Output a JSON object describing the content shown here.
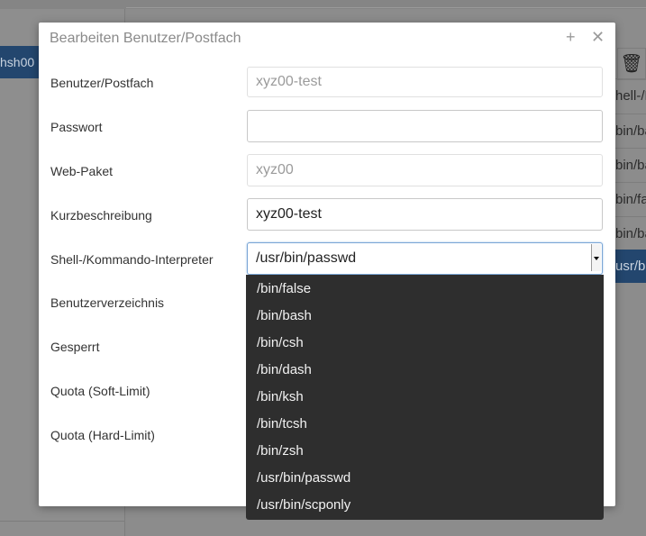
{
  "background": {
    "left_selected_text": "hsh00",
    "right_rows": [
      "hell-/K",
      "bin/ba",
      "bin/ba",
      "bin/fal",
      "bin/ba"
    ],
    "right_selected_text": "usr/bi",
    "trash_icon": "trash-icon"
  },
  "dialog": {
    "title": "Bearbeiten Benutzer/Postfach",
    "maximize_icon": "plus-icon",
    "close_icon": "close-icon",
    "fields": {
      "user": {
        "label": "Benutzer/Postfach",
        "value": "xyz00-test"
      },
      "password": {
        "label": "Passwort",
        "value": ""
      },
      "webpackage": {
        "label": "Web-Paket",
        "value": "xyz00"
      },
      "description": {
        "label": "Kurzbeschreibung",
        "value": "xyz00-test"
      },
      "shell": {
        "label": "Shell-/Kommando-Interpreter",
        "value": "/usr/bin/passwd"
      },
      "homedir": {
        "label": "Benutzerverzeichnis"
      },
      "locked": {
        "label": "Gesperrt"
      },
      "quota_soft": {
        "label": "Quota (Soft-Limit)"
      },
      "quota_hard": {
        "label": "Quota (Hard-Limit)"
      }
    },
    "shell_options": [
      "/bin/false",
      "/bin/bash",
      "/bin/csh",
      "/bin/dash",
      "/bin/ksh",
      "/bin/tcsh",
      "/bin/zsh",
      "/usr/bin/passwd",
      "/usr/bin/scponly"
    ]
  }
}
